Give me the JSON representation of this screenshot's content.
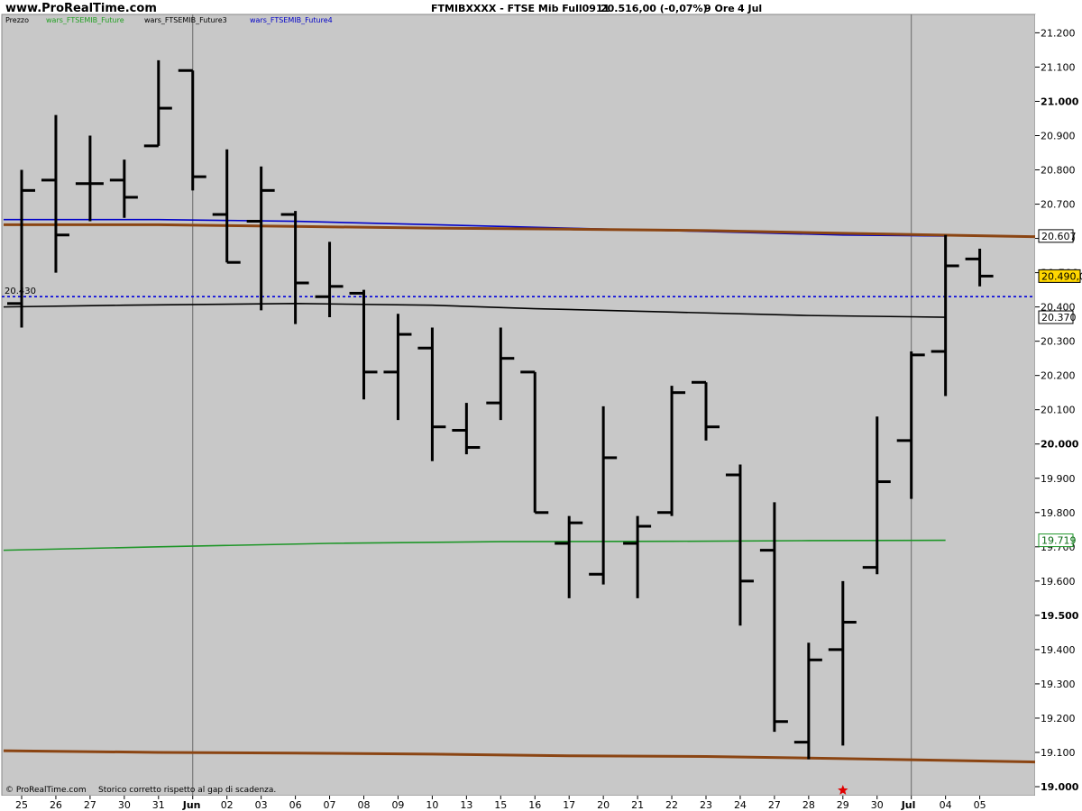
{
  "header": {
    "site": "www.ProRealTime.com",
    "title": "FTMIBXXXX - FTSE Mib Full0911",
    "price": "20.516,00 (-0,07%)",
    "timeframe": "9 Ore",
    "date": "4 Jul"
  },
  "legend": [
    {
      "label": "Prezzo",
      "color": "#000000"
    },
    {
      "label": "wars_FTSEMIB_Future",
      "color": "#22a022"
    },
    {
      "label": "wars_FTSEMIB_Future3",
      "color": "#000000"
    },
    {
      "label": "wars_FTSEMIB_Future4",
      "color": "#0000c8"
    }
  ],
  "footer": {
    "copyright": "© ProRealTime.com",
    "note": "Storico corretto rispetto al gap di scadenza."
  },
  "colors": {
    "plot_bg": "#c8c8c8",
    "bars": "#000000",
    "green_line": "#1e9628",
    "black_line": "#000000",
    "blue_line": "#0000c8",
    "brown_line": "#8b4513",
    "dotted_line": "#0000dc",
    "label_highlight": "#ffd700",
    "marker": "#e00000"
  },
  "chart_data": {
    "type": "ohlc",
    "x_labels": [
      "25",
      "26",
      "27",
      "30",
      "31",
      "Jun",
      "02",
      "03",
      "06",
      "07",
      "08",
      "09",
      "10",
      "13",
      "15",
      "16",
      "17",
      "20",
      "21",
      "22",
      "23",
      "24",
      "27",
      "28",
      "29",
      "30",
      "Jul",
      "04",
      "05"
    ],
    "y_ticks": [
      "21.200",
      "21.100",
      "21.000",
      "20.900",
      "20.800",
      "20.700",
      "20.600",
      "20.500",
      "20.400",
      "20.300",
      "20.200",
      "20.100",
      "20.000",
      "19.900",
      "19.800",
      "19.700",
      "19.600",
      "19.500",
      "19.400",
      "19.300",
      "19.200",
      "19.100",
      "19.000"
    ],
    "ylim": [
      19000,
      21230
    ],
    "bars": [
      {
        "o": 20410,
        "h": 20800,
        "l": 20340,
        "c": 20740
      },
      {
        "o": 20770,
        "h": 20960,
        "l": 20500,
        "c": 20610
      },
      {
        "o": 20760,
        "h": 20900,
        "l": 20650,
        "c": 20760
      },
      {
        "o": 20770,
        "h": 20830,
        "l": 20660,
        "c": 20720
      },
      {
        "o": 20870,
        "h": 21120,
        "l": 20870,
        "c": 20980
      },
      {
        "o": 21090,
        "h": 21090,
        "l": 20740,
        "c": 20780
      },
      {
        "o": 20670,
        "h": 20860,
        "l": 20530,
        "c": 20530
      },
      {
        "o": 20650,
        "h": 20810,
        "l": 20390,
        "c": 20740
      },
      {
        "o": 20670,
        "h": 20680,
        "l": 20350,
        "c": 20470
      },
      {
        "o": 20430,
        "h": 20590,
        "l": 20370,
        "c": 20460
      },
      {
        "o": 20440,
        "h": 20450,
        "l": 20130,
        "c": 20210
      },
      {
        "o": 20210,
        "h": 20380,
        "l": 20070,
        "c": 20320
      },
      {
        "o": 20280,
        "h": 20340,
        "l": 19950,
        "c": 20050
      },
      {
        "o": 20040,
        "h": 20120,
        "l": 19970,
        "c": 19990
      },
      {
        "o": 20120,
        "h": 20340,
        "l": 20070,
        "c": 20250
      },
      {
        "o": 20210,
        "h": 20210,
        "l": 19800,
        "c": 19800
      },
      {
        "o": 19710,
        "h": 19790,
        "l": 19550,
        "c": 19770
      },
      {
        "o": 19620,
        "h": 20110,
        "l": 19590,
        "c": 19960
      },
      {
        "o": 19710,
        "h": 19790,
        "l": 19550,
        "c": 19760
      },
      {
        "o": 19800,
        "h": 20170,
        "l": 19790,
        "c": 20150
      },
      {
        "o": 20180,
        "h": 20180,
        "l": 20010,
        "c": 20050
      },
      {
        "o": 19910,
        "h": 19940,
        "l": 19470,
        "c": 19600
      },
      {
        "o": 19690,
        "h": 19830,
        "l": 19160,
        "c": 19190
      },
      {
        "o": 19130,
        "h": 19420,
        "l": 19080,
        "c": 19370
      },
      {
        "o": 19400,
        "h": 19600,
        "l": 19120,
        "c": 19480
      },
      {
        "o": 19640,
        "h": 20080,
        "l": 19620,
        "c": 19890
      },
      {
        "o": 20010,
        "h": 20270,
        "l": 19840,
        "c": 20260
      },
      {
        "o": 20270,
        "h": 20610,
        "l": 20140,
        "c": 20520
      },
      {
        "o": 20540,
        "h": 20570,
        "l": 20460,
        "c": 20490
      }
    ],
    "series": [
      {
        "name": "wars_FTSEMIB_Future",
        "values": [
          [
            0,
            19690
          ],
          [
            4,
            19700
          ],
          [
            9,
            19710
          ],
          [
            14,
            19715
          ],
          [
            19,
            19716
          ],
          [
            23,
            19718
          ],
          [
            27,
            19719
          ]
        ]
      },
      {
        "name": "wars_FTSEMIB_Future3",
        "values": [
          [
            0,
            20400
          ],
          [
            3,
            20405
          ],
          [
            8,
            20410
          ],
          [
            12,
            20405
          ],
          [
            15,
            20395
          ],
          [
            19,
            20385
          ],
          [
            23,
            20375
          ],
          [
            27,
            20370
          ]
        ]
      },
      {
        "name": "wars_FTSEMIB_Future4",
        "values": [
          [
            0,
            20655
          ],
          [
            4,
            20655
          ],
          [
            8,
            20650
          ],
          [
            12,
            20640
          ],
          [
            16,
            20630
          ],
          [
            20,
            20620
          ],
          [
            24,
            20610
          ],
          [
            27,
            20607
          ]
        ]
      },
      {
        "name": "",
        "values": [
          [
            0,
            20640
          ],
          [
            4,
            20640
          ],
          [
            8,
            20635
          ],
          [
            12,
            20630
          ],
          [
            16,
            20627
          ],
          [
            20,
            20623
          ],
          [
            24,
            20615
          ],
          [
            29,
            20605
          ]
        ]
      },
      {
        "name": "",
        "values": [
          [
            0,
            19105
          ],
          [
            4,
            19100
          ],
          [
            8,
            19098
          ],
          [
            12,
            19095
          ],
          [
            16,
            19090
          ],
          [
            20,
            19088
          ],
          [
            24,
            19082
          ],
          [
            29,
            19072
          ]
        ]
      }
    ],
    "dotted_level": 20430,
    "dotted_label": "20.430",
    "marker_bar": 24,
    "right_labels": [
      {
        "value": 20607,
        "text": "20.607",
        "style": "plain"
      },
      {
        "value": 20490,
        "text": "20.490,0",
        "style": "highlight"
      },
      {
        "value": 20370,
        "text": "20.370",
        "style": "plain"
      },
      {
        "value": 19719,
        "text": "19.719",
        "style": "green"
      }
    ]
  }
}
